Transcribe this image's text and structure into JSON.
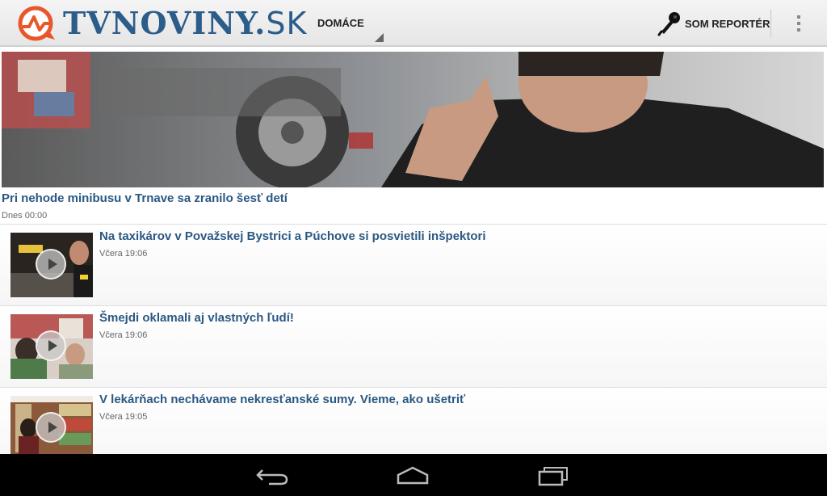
{
  "app": {
    "logo_text": "TVNOVINY",
    "logo_dot": ".",
    "logo_tld": "SK",
    "brand_color": "#2c5d8a",
    "logo_accent": "#e8562a"
  },
  "actionbar": {
    "section_selected": "DOMÁCE",
    "reporter_label": "SOM REPORTÉR",
    "reporter_icon": "microphone-icon",
    "overflow_icon": "overflow-menu-icon"
  },
  "hero": {
    "title": "Pri nehode minibusu v Trnave sa zranilo šesť detí",
    "date": "Dnes 00:00"
  },
  "articles": [
    {
      "title": "Na taxikárov v Považskej Bystrici a Púchove si posvietili inšpektori",
      "date": "Včera 19:06",
      "has_video": true
    },
    {
      "title": "Šmejdi oklamali aj vlastných ľudí!",
      "date": "Včera 19:06",
      "has_video": true
    },
    {
      "title": "V lekárňach nechávame nekresťanské sumy. Vieme, ako ušetriť",
      "date": "Včera 19:05",
      "has_video": true
    }
  ],
  "navbar": {
    "back_icon": "back-icon",
    "home_icon": "home-icon",
    "recents_icon": "recent-apps-icon"
  }
}
